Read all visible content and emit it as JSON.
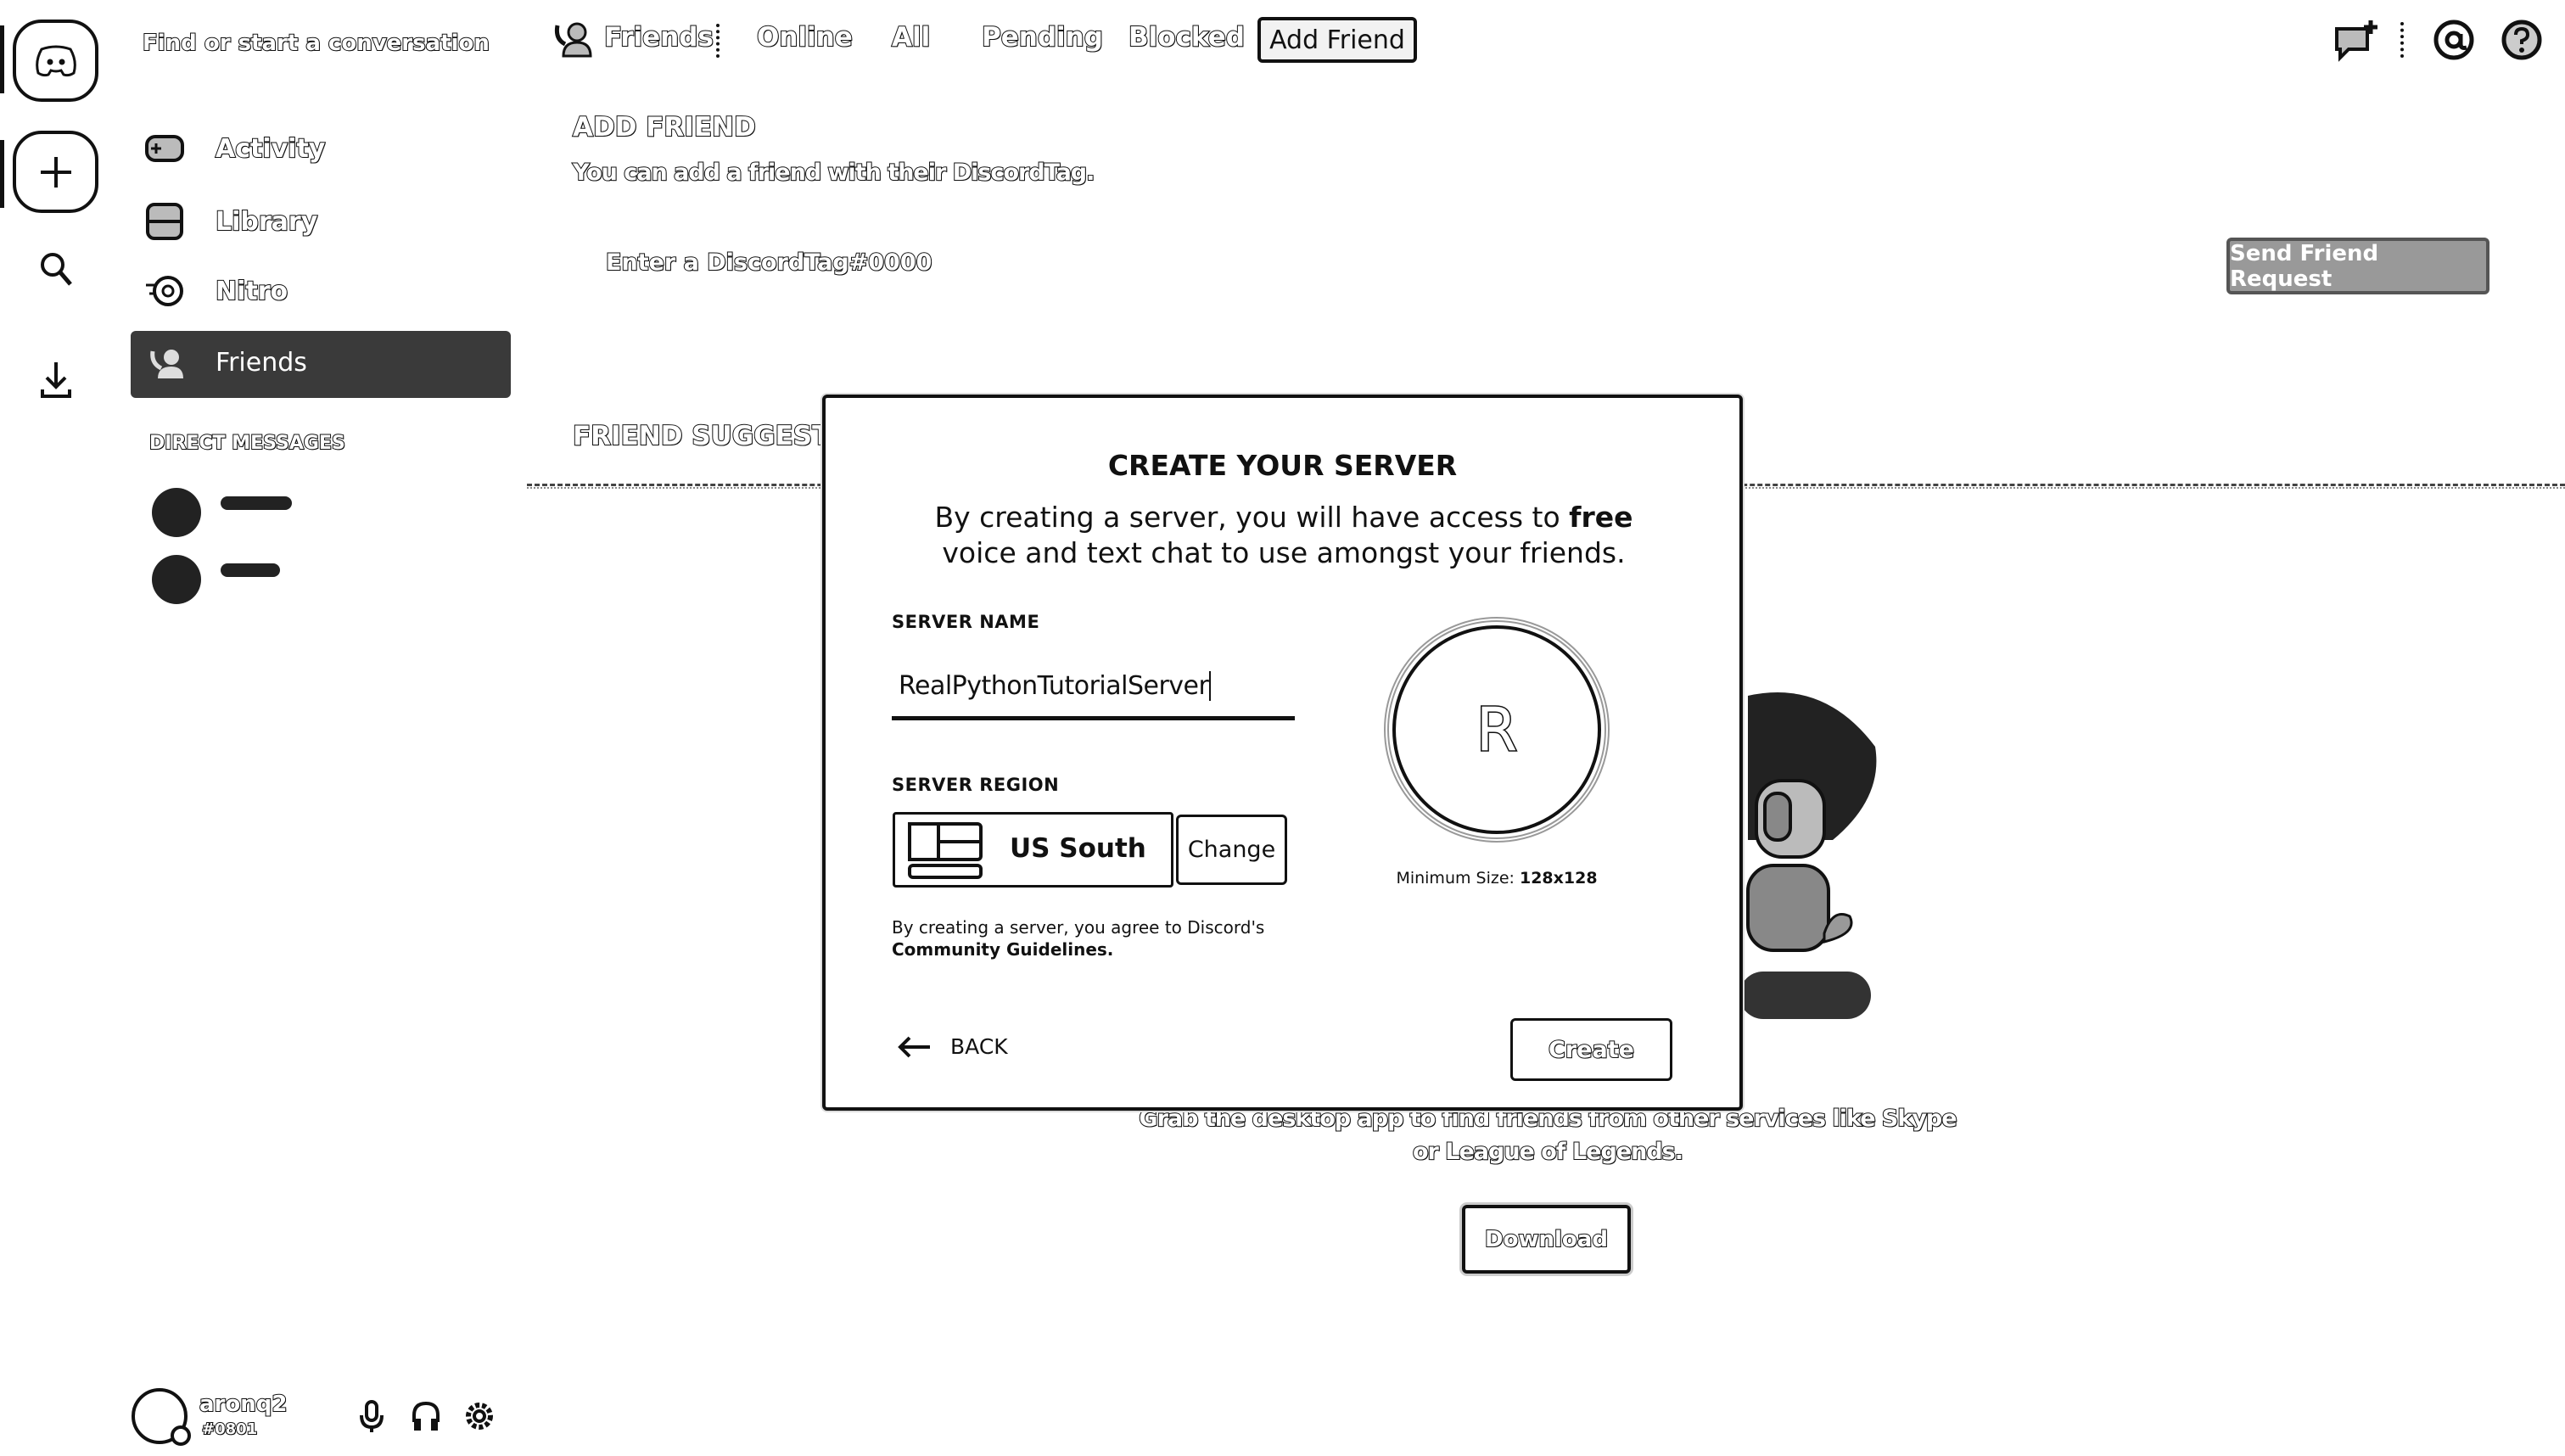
{
  "search": {
    "placeholder": "Find or start a conversation"
  },
  "sidebar": {
    "items": [
      {
        "label": "Activity"
      },
      {
        "label": "Library"
      },
      {
        "label": "Nitro"
      },
      {
        "label": "Friends"
      }
    ],
    "dm_header": "DIRECT MESSAGES"
  },
  "user": {
    "name": "aronq2",
    "tag": "#0801"
  },
  "nav": {
    "tabs": [
      "Friends",
      "Online",
      "All",
      "Pending",
      "Blocked"
    ],
    "add_friend": "Add Friend"
  },
  "add_friend": {
    "title": "ADD FRIEND",
    "subtitle": "You can add a friend with their DiscordTag.",
    "placeholder": "Enter a DiscordTag#0000",
    "send": "Send Friend Request"
  },
  "suggestions": {
    "title": "FRIEND SUGGESTIONS"
  },
  "desktop": {
    "line1": "Grab the desktop app to find friends from other services like Skype",
    "line2": "or League of Legends.",
    "download": "Download"
  },
  "modal": {
    "title": "CREATE YOUR SERVER",
    "desc_pre": "By creating a server, you will have access to ",
    "desc_bold": "free",
    "desc_post": " voice and text chat to use amongst your friends.",
    "server_name_label": "SERVER NAME",
    "server_name_value": "RealPythonTutorialServer",
    "region_label": "SERVER REGION",
    "region": "US South",
    "change": "Change",
    "avatar_letter": "R",
    "min_size_label": "Minimum Size: ",
    "min_size_value": "128x128",
    "agree_text": "By creating a server, you agree to Discord's",
    "guidelines": "Community Guidelines.",
    "back": "BACK",
    "create": "Create"
  }
}
